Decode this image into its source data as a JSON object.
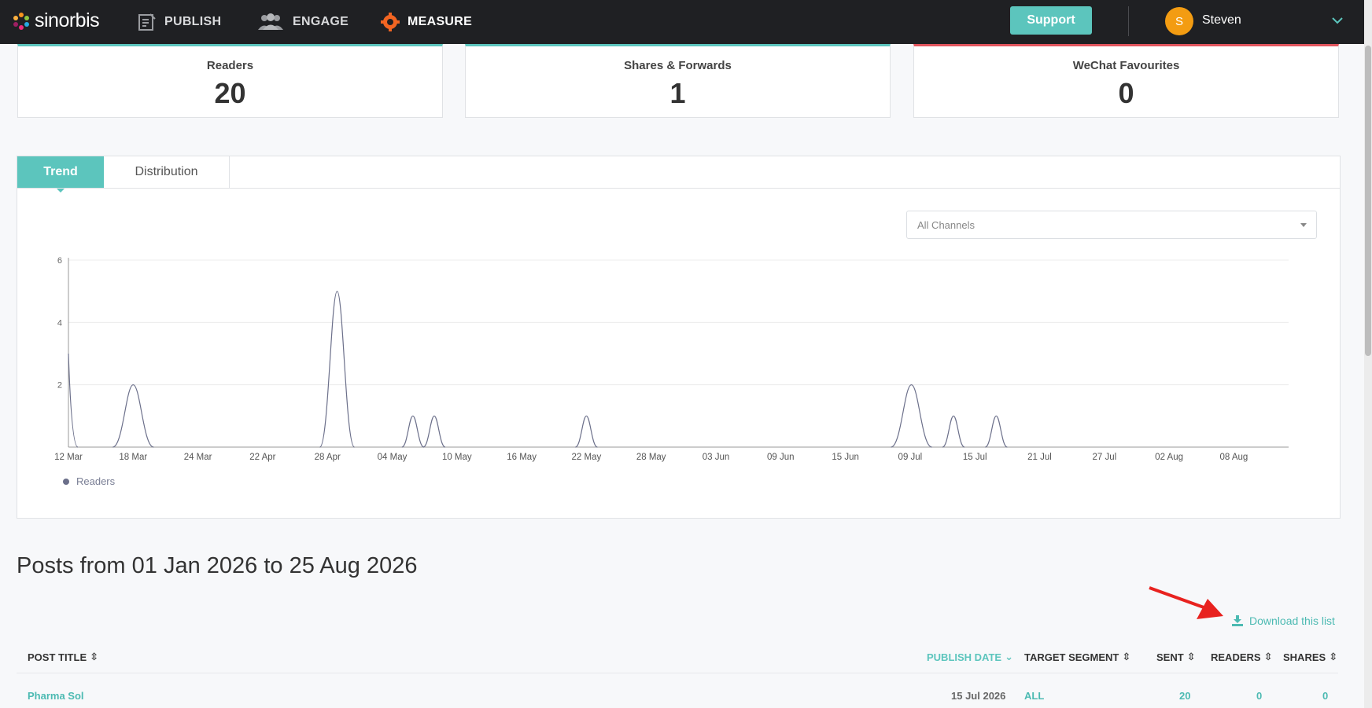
{
  "nav": {
    "logo": "sinorbis",
    "items": [
      {
        "label": "PUBLISH",
        "icon": "publish-icon"
      },
      {
        "label": "ENGAGE",
        "icon": "engage-icon"
      },
      {
        "label": "MEASURE",
        "icon": "gear-icon"
      }
    ],
    "support_label": "Support",
    "user_initial": "S",
    "user_name": "Steven"
  },
  "stats": [
    {
      "label": "Readers",
      "value": "20"
    },
    {
      "label": "Shares & Forwards",
      "value": "1"
    },
    {
      "label": "WeChat Favourites",
      "value": "0"
    }
  ],
  "tabs": {
    "active": "Trend",
    "other": "Distribution"
  },
  "channel_select": {
    "value": "All Channels"
  },
  "chart_data": {
    "type": "line",
    "series": [
      {
        "name": "Readers",
        "color": "#6b6f8a",
        "values": [
          3,
          0,
          2,
          0,
          5,
          1,
          1,
          0,
          1,
          0,
          2,
          1,
          1,
          0
        ]
      }
    ],
    "x_positions": [
      "12 Mar",
      "17 Mar",
      "29 Apr",
      "05 May",
      "08 May",
      "12 May",
      "22 May",
      "08 Jul",
      "13 Jul",
      "17 Jul"
    ],
    "x": [
      "12 Mar",
      "18 Mar",
      "24 Mar",
      "22 Apr",
      "28 Apr",
      "04 May",
      "10 May",
      "16 May",
      "22 May",
      "28 May",
      "03 Jun",
      "09 Jun",
      "15 Jun",
      "09 Jul",
      "15 Jul",
      "21 Jul",
      "27 Jul",
      "02 Aug",
      "08 Aug"
    ],
    "peaks": [
      {
        "date": "12 Mar",
        "value": 3
      },
      {
        "date": "17 Mar",
        "value": 2
      },
      {
        "date": "29 Apr",
        "value": 5
      },
      {
        "date": "05 May",
        "value": 1
      },
      {
        "date": "08 May",
        "value": 1
      },
      {
        "date": "22 May",
        "value": 1
      },
      {
        "date": "09 Jul",
        "value": 2
      },
      {
        "date": "13 Jul",
        "value": 1
      },
      {
        "date": "17 Jul",
        "value": 1
      }
    ],
    "y_ticks": [
      2,
      4,
      6
    ],
    "ylim": [
      0,
      6
    ],
    "legend": "bottom-left"
  },
  "posts": {
    "title": "Posts from 01 Jan 2026 to 25 Aug 2026",
    "download_label": "Download this list",
    "columns": [
      "POST TITLE",
      "PUBLISH DATE",
      "TARGET SEGMENT",
      "SENT",
      "READERS",
      "SHARES"
    ],
    "rows": [
      {
        "title": "Pharma Sol",
        "date": "15 Jul 2026",
        "segment": "ALL",
        "sent": "20",
        "readers": "0",
        "shares": "0"
      }
    ]
  }
}
